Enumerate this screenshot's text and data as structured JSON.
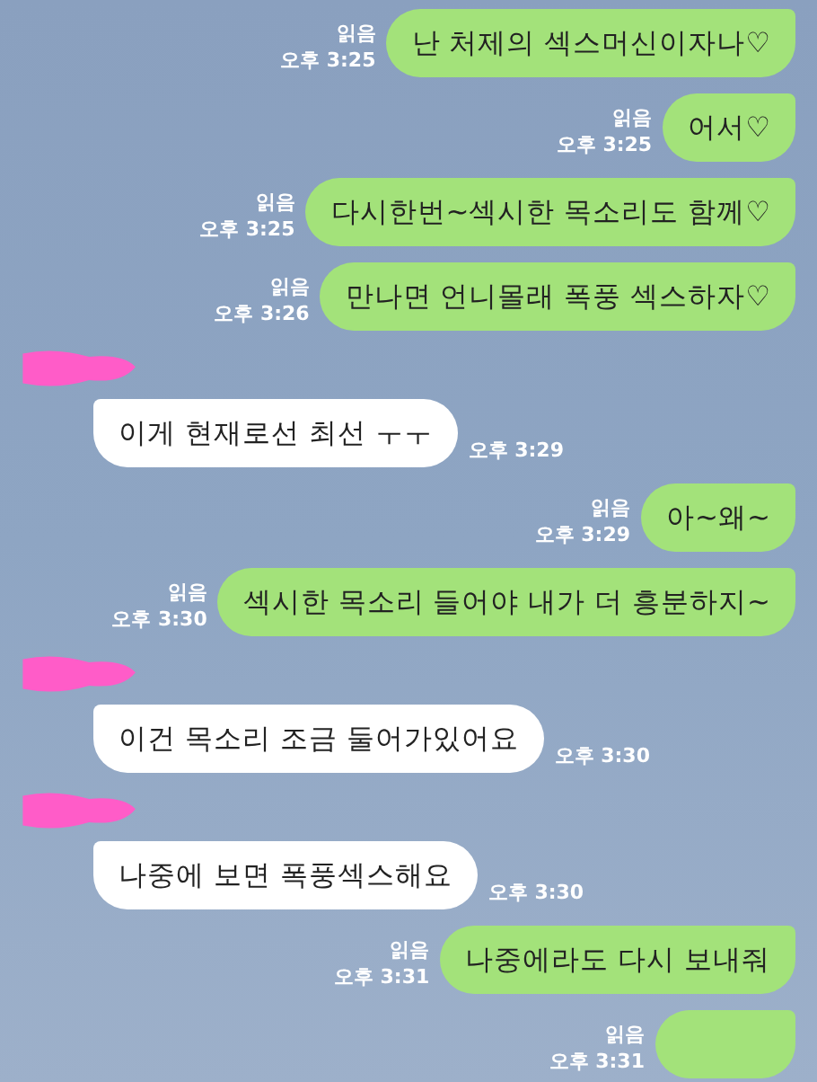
{
  "messages": [
    {
      "kind": "sent",
      "text": "난 처제의 섹스머신이자나♡",
      "read": "읽음",
      "time": "오후 3:25"
    },
    {
      "kind": "sent",
      "text": "어서♡",
      "read": "읽음",
      "time": "오후 3:25"
    },
    {
      "kind": "sent",
      "text": "다시한번~섹시한 목소리도 함께♡",
      "read": "읽음",
      "time": "오후 3:25"
    },
    {
      "kind": "sent",
      "text": "만나면 언니몰래 폭풍 섹스하자♡",
      "read": "읽음",
      "time": "오후 3:26"
    },
    {
      "kind": "received",
      "text": "이게 현재로선 최선 ㅜㅜ",
      "time": "오후 3:29"
    },
    {
      "kind": "sent",
      "text": "아~왜~",
      "read": "읽음",
      "time": "오후 3:29"
    },
    {
      "kind": "sent",
      "text": "섹시한 목소리 들어야 내가 더 흥분하지~",
      "read": "읽음",
      "time": "오후 3:30"
    },
    {
      "kind": "received",
      "text": "이건 목소리 조금 둘어가있어요",
      "time": "오후 3:30"
    },
    {
      "kind": "received",
      "text": "나중에 보면 폭풍섹스해요",
      "time": "오후 3:30"
    },
    {
      "kind": "sent",
      "text": "나중에라도 다시 보내줘",
      "read": "읽음",
      "time": "오후 3:31"
    },
    {
      "kind": "sent",
      "read": "읽음",
      "time": "오후 3:31"
    }
  ]
}
